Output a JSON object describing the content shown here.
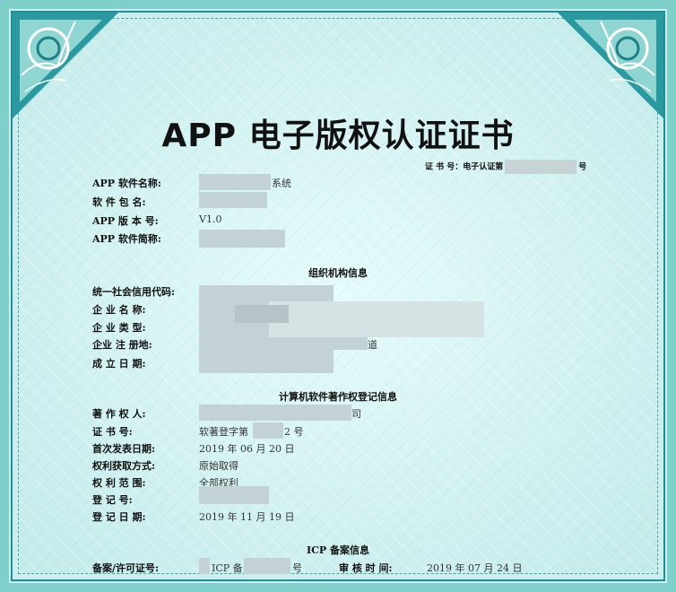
{
  "title": "APP 电子版权认证证书",
  "cert_number": {
    "prefix": "证 书 号：电子认证第",
    "suffix": "号"
  },
  "app_info": {
    "name_label": "APP 软件名称:",
    "name_value": "系统",
    "package_label": "软 件 包 名:",
    "version_label": "APP 版 本 号:",
    "version_value": "V1.0",
    "short_label": "APP 软件简称:"
  },
  "org_section": {
    "heading": "组织机构信息",
    "credit_label": "统一社会信用代码:",
    "name_label": "企 业 名 称:",
    "type_label": "企 业 类 型:",
    "address_label": "企业 注 册地:",
    "address_fragment": "道",
    "founded_label": "成 立 日 期:"
  },
  "copyright_section": {
    "heading": "计算机软件著作权登记信息",
    "owner_label": "著 作 权 人:",
    "owner_fragment": "司",
    "certno_label": "证 书 号:",
    "certno_prefix": "软著登字第",
    "certno_suffix": "2 号",
    "first_pub_label": "首次发表日期:",
    "first_pub_value": "2019 年 06 月 20 日",
    "acquire_label": "权利获取方式:",
    "acquire_value": "原始取得",
    "scope_label": "权 利 范 围:",
    "scope_value": "全部权利",
    "reg_no_label": "登 记 号:",
    "reg_date_label": "登 记 日 期:",
    "reg_date_value": "2019 年 11 月 19 日"
  },
  "icp_section": {
    "heading": "ICP 备案信息",
    "license_label": "备案/许可证号:",
    "license_prefix": "ICP 备",
    "license_suffix": "号",
    "review_label": "审 核 时 间:",
    "review_value": "2019 年 07 月 24 日"
  },
  "colors": {
    "background": "#cdeeee",
    "border": "#1e8f96",
    "text": "#111111"
  }
}
